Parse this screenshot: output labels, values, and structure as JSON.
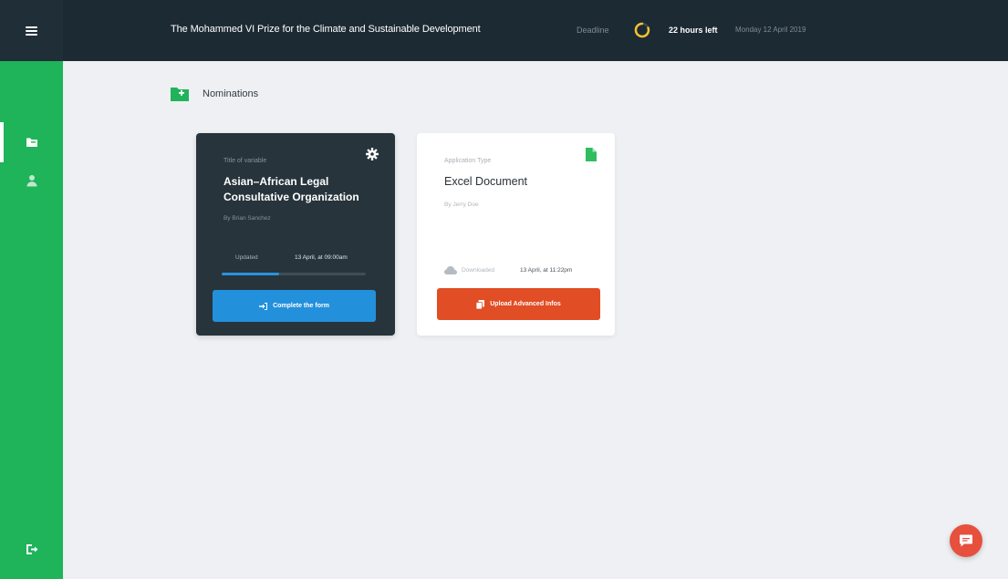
{
  "colors": {
    "sidebar": "#1fb35a",
    "header": "#1c2a33",
    "background": "#eef0f3",
    "dark_card": "#27343c",
    "accent_blue": "#2390db",
    "accent_orange": "#e14d24",
    "deadline_ring": "#f2c230",
    "chat": "#e6503d"
  },
  "sidebar": {
    "menu_icon": "hamburger-menu-icon",
    "items": [
      {
        "icon": "folder-icon",
        "active": true
      },
      {
        "icon": "user-icon",
        "active": false
      }
    ],
    "logout_icon": "logout-icon"
  },
  "header": {
    "title": "The Mohammed VI Prize for the Climate and Sustainable Development",
    "deadline_label": "Deadline",
    "hours_left": "22 hours left",
    "deadline_date": "Monday 12 April 2019"
  },
  "section": {
    "icon": "folder-plus-icon",
    "title": "Nominations"
  },
  "cards": [
    {
      "eyebrow": "Title of variable",
      "title": "Asian–African Legal Consultative Organization",
      "byline": "By Brian Sanchez",
      "meta_label": "Updated",
      "meta_value": "13 April, at 09:00am",
      "progress": 0.4,
      "button_label": "Complete the form",
      "button_icon": "sign-in-icon"
    },
    {
      "eyebrow": "Application Type",
      "title": "Excel Document",
      "byline": "By Jerry Doe",
      "meta_label": "Downloaded",
      "meta_value": "13 April, at 11:22pm",
      "button_label": "Upload Advanced Infos",
      "button_icon": "copy-icon",
      "file_icon": "file-icon",
      "meta_icon": "cloud-icon"
    }
  ],
  "chat": {
    "icon": "chat-bubble-icon"
  }
}
